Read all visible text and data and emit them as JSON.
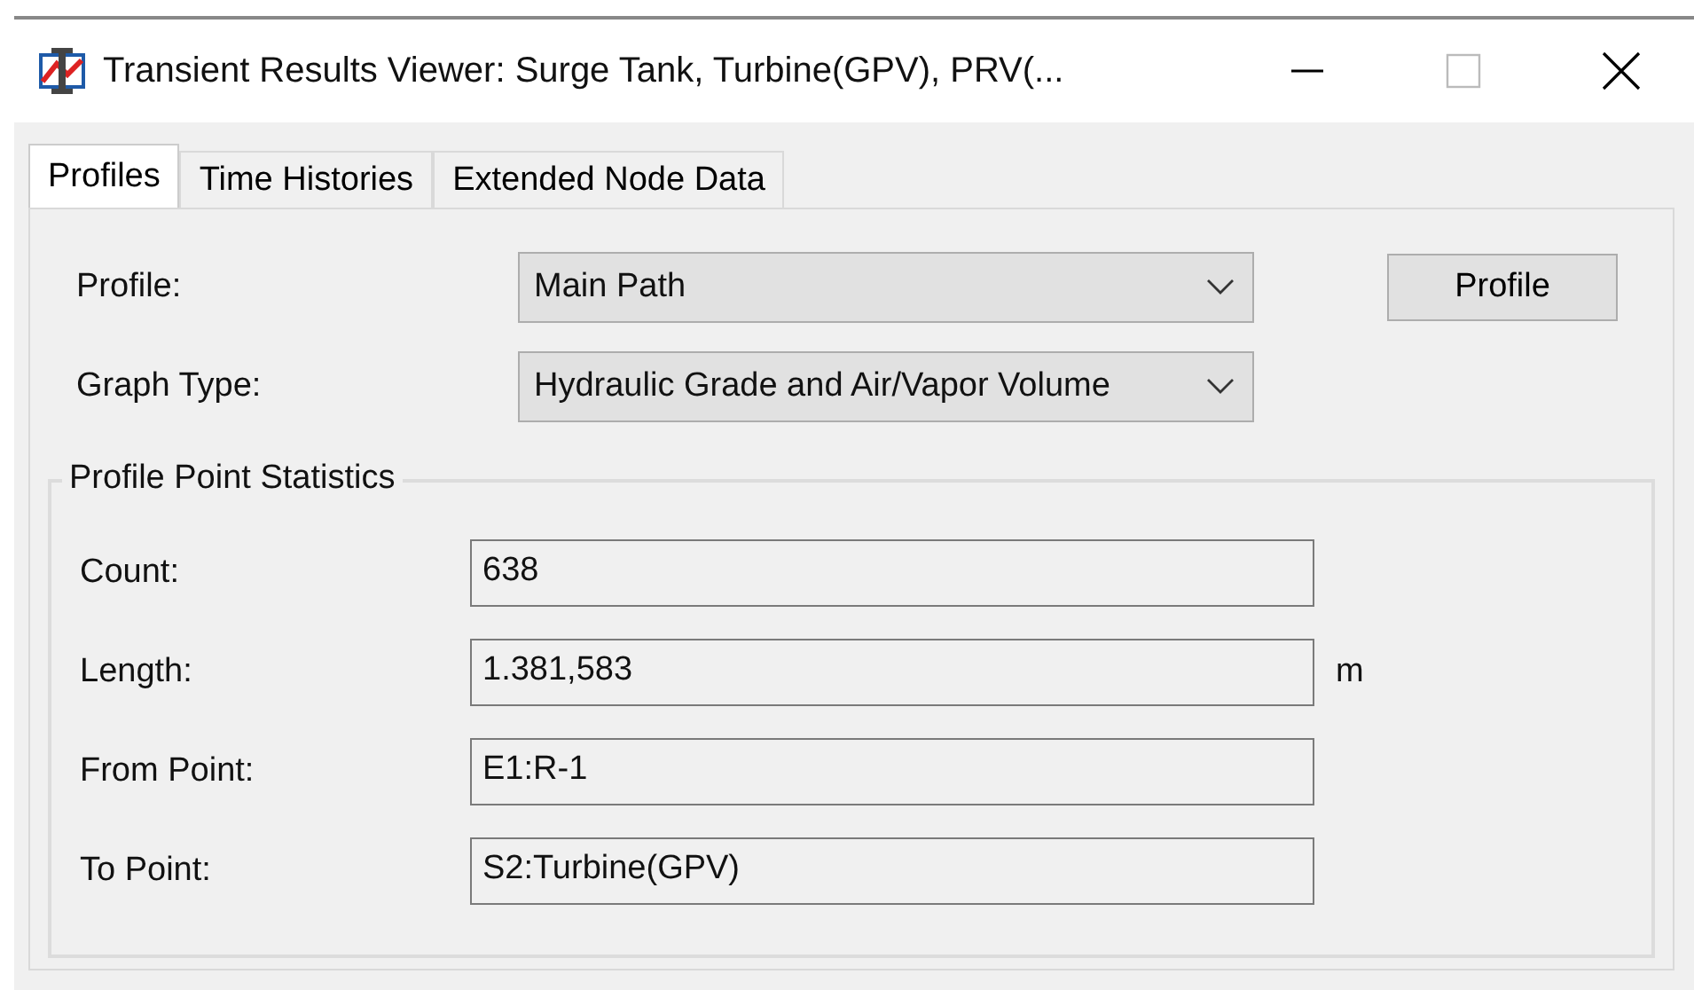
{
  "window": {
    "title": "Transient Results Viewer: Surge Tank, Turbine(GPV), PRV(..."
  },
  "tabs": [
    {
      "label": "Profiles",
      "selected": true
    },
    {
      "label": "Time Histories",
      "selected": false
    },
    {
      "label": "Extended Node Data",
      "selected": false
    }
  ],
  "profile": {
    "label": "Profile:",
    "value": "Main Path",
    "button": "Profile"
  },
  "graph_type": {
    "label": "Graph Type:",
    "value": "Hydraulic Grade and Air/Vapor Volume"
  },
  "statistics": {
    "title": "Profile Point Statistics",
    "fields": [
      {
        "label": "Count:",
        "value": "638"
      },
      {
        "label": "Length:",
        "value": "1.381,583",
        "unit": "m"
      },
      {
        "label": "From Point:",
        "value": "E1:R-1"
      },
      {
        "label": "To Point:",
        "value": "S2:Turbine(GPV)"
      }
    ]
  }
}
